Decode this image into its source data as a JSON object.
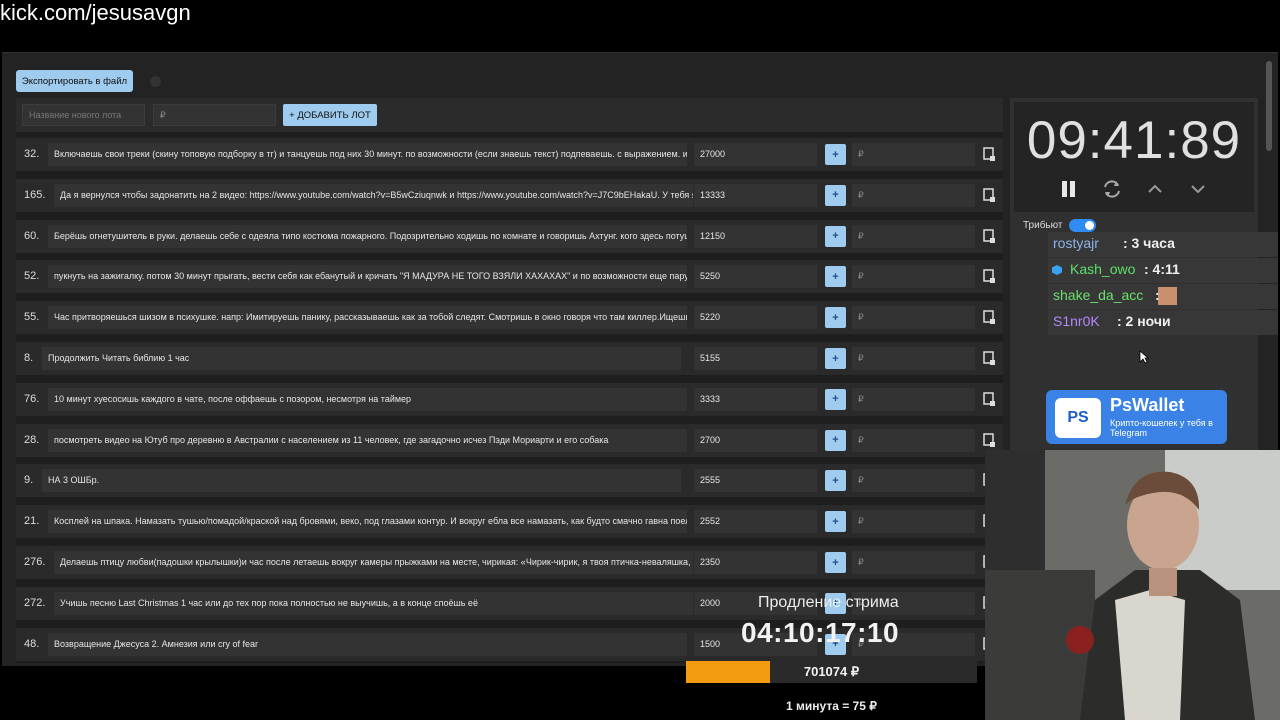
{
  "url": "kick.com/jesusavgn",
  "toolbar": {
    "export_label": "Экспортировать в файл"
  },
  "add_lot": {
    "name_placeholder": "Название нового лота",
    "price_placeholder": "₽",
    "add_label": "+ ДОБАВИТЬ ЛОТ"
  },
  "lots": [
    {
      "num": "32.",
      "text": "Включаешь свои треки (скину топовую подборку в тг) и танцуешь под них 30 минут. по возможности (если знаешь текст) подпеваешь. с выражением. и и",
      "amount": "27000"
    },
    {
      "num": "165.",
      "text": "Да я вернулся чтобы задонатить на 2 видео: https://www.youtube.com/watch?v=B5wCziuqnwk и https://www.youtube.com/watch?v=J7C9bEHakaU. У тебя я",
      "amount": "13333"
    },
    {
      "num": "60.",
      "text": "Берёшь огнетушитель в руки. делаешь себе с одеяла типо костюма пожарного. Подозрительно ходишь по комнате и говоришь Ахтунг. кого здесь потуш",
      "amount": "12150"
    },
    {
      "num": "52.",
      "text": "пукнуть на зажигалку. потом 30 минут прыгать, вести себя как ебанутый и кричать \"Я МАДУРА НЕ ТОГО ВЗЯЛИ ХАХАХАХ\" и по возможности еще пару р",
      "amount": "5250"
    },
    {
      "num": "55.",
      "text": "Час притворяешься шизом в психушке. напр: Имитируешь панику, рассказываешь как за тобой следят. Смотришь в окно говоря что там киллер.Ищешь с",
      "amount": "5220"
    },
    {
      "num": "8.",
      "text": "Продолжить Читать библию 1 час",
      "amount": "5155"
    },
    {
      "num": "76.",
      "text": "10 минут хуесосишь каждого в чате, после оффаешь с позором, несмотря на таймер",
      "amount": "3333"
    },
    {
      "num": "28.",
      "text": "посмотреть видео на Ютуб про деревню в Австралии с населением из 11 человек, где загадочно исчез Пэди Мориарти и его собака",
      "amount": "2700"
    },
    {
      "num": "9.",
      "text": "НА 3 ОШБр.",
      "amount": "2555"
    },
    {
      "num": "21.",
      "text": "Косплей на шпака. Намазать тушью/помадой/краской над бровями, веко, под глазами контур. И вокруг ебла все намазать, как будто смачно гавна поел.",
      "amount": "2552"
    },
    {
      "num": "276.",
      "text": "Делаешь птицу любви(падошки крылышки)и час после летаешь вокруг камеры прыжками на месте, чирикая: «Чирик-чирик, я твоя птичка-неваляшка, і",
      "amount": "2350"
    },
    {
      "num": "272.",
      "text": "Учишь песню Last Christmas 1 час или до тех пор пока полностью не выучишь, а в конце споёшь её",
      "amount": "2000"
    },
    {
      "num": "48.",
      "text": "Возвращение Джесуса 2. Амнезия или cry of fear",
      "amount": "1500"
    }
  ],
  "lot_input_placeholder": "₽",
  "timer": {
    "value": "09:41:89"
  },
  "tribute": {
    "label": "Трибьют"
  },
  "donors": [
    {
      "name": "rostyajr",
      "value": ": 3 часа",
      "color": "#8fb4e8"
    },
    {
      "name": "Kash_owo",
      "value": ": 4:11",
      "color": "#5ee06a"
    },
    {
      "name": "shake_da_acc",
      "value": ":",
      "color": "#6ee06e"
    },
    {
      "name": "S1nr0K",
      "value": ": 2 ночи",
      "color": "#b388ff"
    }
  ],
  "ad": {
    "logo": "PS",
    "title": "PsWallet",
    "subtitle": "Крипто-кошелек у тебя в Telegram"
  },
  "extension": {
    "title": "Продление стрима",
    "time": "04:10:17:10",
    "total": "701074 ₽",
    "progress": 0.29,
    "rate": "1 минута = 75 ₽"
  }
}
